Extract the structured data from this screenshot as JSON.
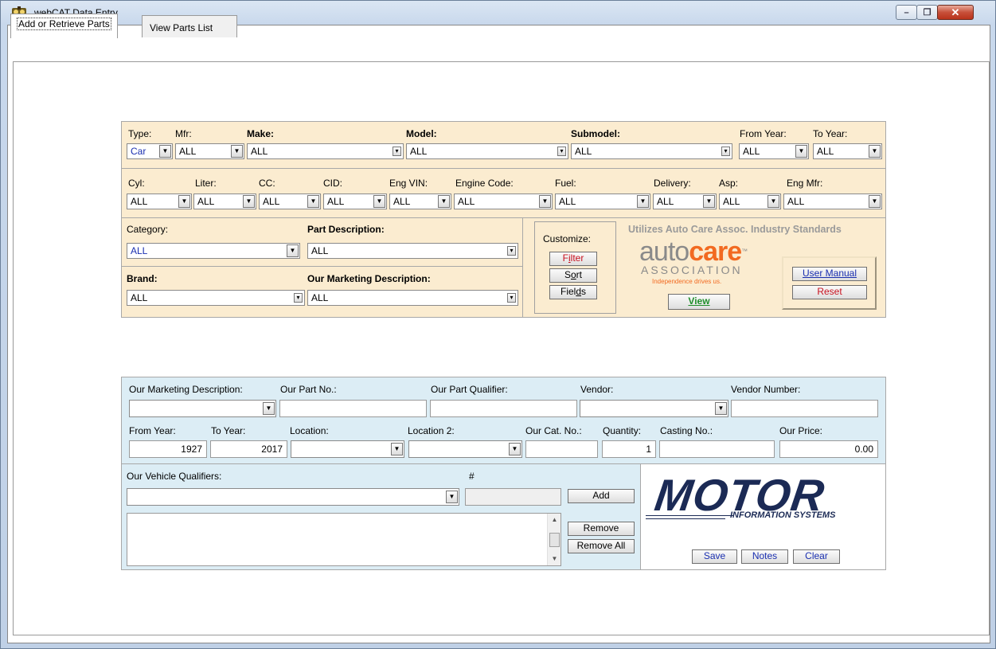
{
  "window": {
    "title": "webCAT Data Entry",
    "min_glyph": "–",
    "max_glyph": "❐",
    "close_glyph": "✕"
  },
  "tabs": [
    {
      "label": "Add or Retrieve Parts"
    },
    {
      "label": "View Parts List"
    }
  ],
  "vehicle_filter": {
    "type": {
      "label": "Type:",
      "value": "Car"
    },
    "mfr": {
      "label": "Mfr:",
      "value": "ALL"
    },
    "make": {
      "label": "Make:",
      "value": "ALL"
    },
    "model": {
      "label": "Model:",
      "value": "ALL"
    },
    "submodel": {
      "label": "Submodel:",
      "value": "ALL"
    },
    "from_year": {
      "label": "From Year:",
      "value": "ALL"
    },
    "to_year": {
      "label": "To Year:",
      "value": "ALL"
    }
  },
  "engine_filter": {
    "cyl": {
      "label": "Cyl:",
      "value": "ALL"
    },
    "liter": {
      "label": "Liter:",
      "value": "ALL"
    },
    "cc": {
      "label": "CC:",
      "value": "ALL"
    },
    "cid": {
      "label": "CID:",
      "value": "ALL"
    },
    "eng_vin": {
      "label": "Eng VIN:",
      "value": "ALL"
    },
    "engine_code": {
      "label": "Engine Code:",
      "value": "ALL"
    },
    "fuel": {
      "label": "Fuel:",
      "value": "ALL"
    },
    "delivery": {
      "label": "Delivery:",
      "value": "ALL"
    },
    "asp": {
      "label": "Asp:",
      "value": "ALL"
    },
    "eng_mfr": {
      "label": "Eng Mfr:",
      "value": "ALL"
    }
  },
  "part_filter": {
    "category": {
      "label": "Category:",
      "value": "ALL"
    },
    "part_description": {
      "label": "Part Description:",
      "value": "ALL"
    },
    "brand": {
      "label": "Brand:",
      "value": "ALL"
    },
    "our_marketing_description": {
      "label": "Our Marketing Description:",
      "value": "ALL"
    }
  },
  "customize": {
    "label": "Customize:",
    "filter_pre": "F",
    "filter_u": "i",
    "filter_post": "lter",
    "sort_pre": "S",
    "sort_u": "o",
    "sort_post": "rt",
    "fields_pre": "Fiel",
    "fields_u": "d",
    "fields_post": "s"
  },
  "autocare": {
    "heading": "Utilizes Auto Care Assoc. Industry Standards",
    "logo_auto": "auto",
    "logo_care": "care",
    "logo_tm": "™",
    "logo_association": "ASSOCIATION",
    "tagline": "Independence drives us.",
    "view_label": "View",
    "user_manual_label": "User Manual",
    "reset_label": "Reset"
  },
  "part_entry": {
    "our_marketing_description": {
      "label": "Our Marketing Description:",
      "value": ""
    },
    "our_part_no": {
      "label": "Our Part No.:",
      "value": ""
    },
    "our_part_qualifier": {
      "label": "Our Part Qualifier:",
      "value": ""
    },
    "vendor": {
      "label": "Vendor:",
      "value": ""
    },
    "vendor_number": {
      "label": "Vendor Number:",
      "value": ""
    },
    "from_year": {
      "label": "From Year:",
      "value": "1927"
    },
    "to_year": {
      "label": "To Year:",
      "value": "2017"
    },
    "location": {
      "label": "Location:",
      "value": ""
    },
    "location2": {
      "label": "Location 2:",
      "value": ""
    },
    "our_cat_no": {
      "label": "Our Cat. No.:",
      "value": ""
    },
    "quantity": {
      "label": "Quantity:",
      "value": "1"
    },
    "casting_no": {
      "label": "Casting No.:",
      "value": ""
    },
    "our_price": {
      "label": "Our Price:",
      "value": "0.00"
    }
  },
  "qualifiers": {
    "label": "Our Vehicle Qualifiers:",
    "hash_label": "#",
    "add_label": "Add",
    "remove_label": "Remove",
    "remove_all_label": "Remove All"
  },
  "motor": {
    "logo_text": "MOTOR",
    "logo_sub": "INFORMATION SYSTEMS",
    "save_label": "Save",
    "notes_label": "Notes",
    "clear_label": "Clear"
  },
  "colors": {
    "filter_panel_bg": "#fbecd0",
    "entry_panel_bg": "#dcedf5",
    "autocare_orange": "#f26a21",
    "motor_navy": "#1b2a55"
  }
}
